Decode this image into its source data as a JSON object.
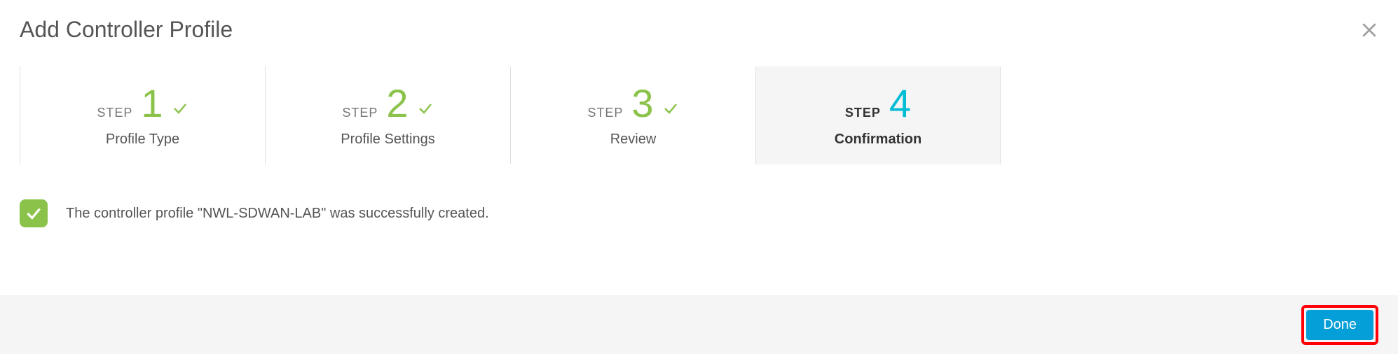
{
  "title": "Add Controller Profile",
  "stepper": {
    "word": "STEP",
    "steps": [
      {
        "num": "1",
        "label": "Profile Type",
        "done": true,
        "active": false
      },
      {
        "num": "2",
        "label": "Profile Settings",
        "done": true,
        "active": false
      },
      {
        "num": "3",
        "label": "Review",
        "done": true,
        "active": false
      },
      {
        "num": "4",
        "label": "Confirmation",
        "done": false,
        "active": true
      }
    ]
  },
  "confirmation_message": "The controller profile \"NWL-SDWAN-LAB\" was successfully created.",
  "buttons": {
    "done": "Done"
  },
  "colors": {
    "accent_green": "#8bc34a",
    "accent_blue": "#00bcd4",
    "primary_btn": "#049fd9",
    "highlight": "#ff0008"
  }
}
